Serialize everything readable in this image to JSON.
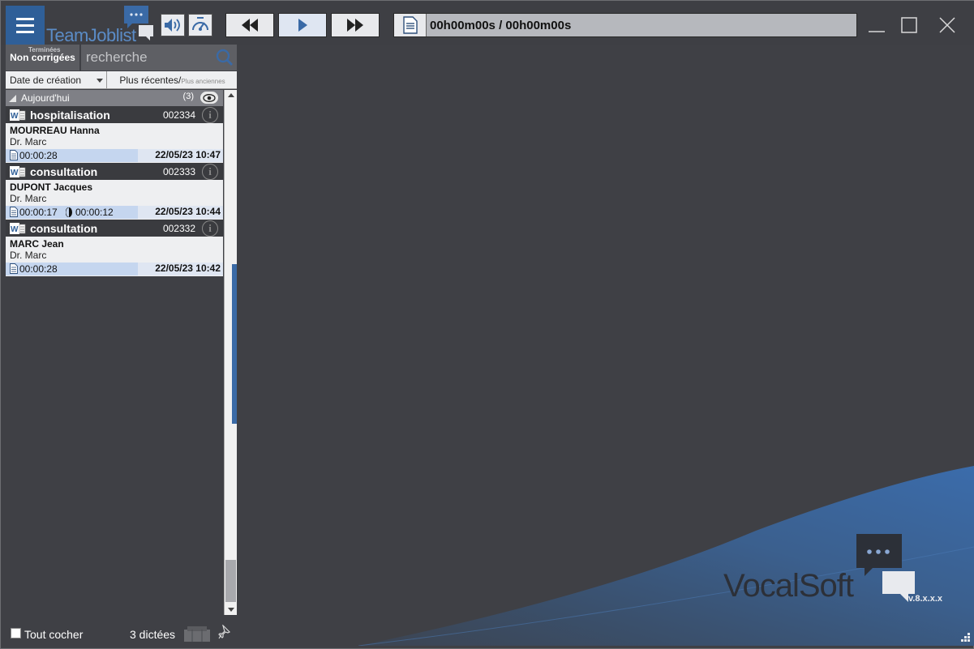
{
  "app": {
    "logo_text": "TeamJoblist",
    "brand_name": "VocalSoft",
    "brand_version": "v.8.x.x.x"
  },
  "player": {
    "time": "00h00m00s / 00h00m00s",
    "rewind_icon": "rewind-icon",
    "play_icon": "play-icon",
    "forward_icon": "fast-forward-icon"
  },
  "filters": {
    "tab_label": "Non corrigées",
    "tab_sublabel": "Terminées",
    "search_placeholder": "recherche",
    "sort_by": "Date de création",
    "order_main": "Plus récentes/",
    "order_alt": "Plus anciennes"
  },
  "group": {
    "label": "Aujourd'hui",
    "count": "(3)"
  },
  "dictations": [
    {
      "type": "hospitalisation",
      "number": "002334",
      "patient": "MOURREAU Hanna",
      "doctor": "Dr. Marc",
      "duration": "00:00:28",
      "duration2": "",
      "date": "22/05/23 10:47"
    },
    {
      "type": "consultation",
      "number": "002333",
      "patient": "DUPONT Jacques",
      "doctor": "Dr. Marc",
      "duration": "00:00:17",
      "duration2": "00:00:12",
      "date": "22/05/23 10:44"
    },
    {
      "type": "consultation",
      "number": "002332",
      "patient": "MARC Jean",
      "doctor": "Dr. Marc",
      "duration": "00:00:28",
      "duration2": "",
      "date": "22/05/23 10:42"
    }
  ],
  "footer": {
    "check_all": "Tout cocher",
    "count": "3 dictées"
  },
  "colors": {
    "accent": "#2f5f98",
    "background": "#3f4045",
    "row_highlight": "#c5d6ef"
  }
}
